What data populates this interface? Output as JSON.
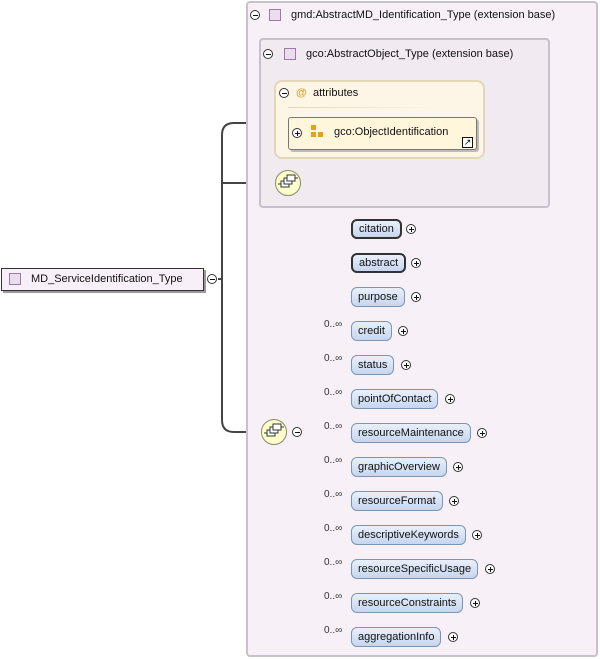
{
  "root": {
    "label": "MD_ServiceIdentification_Type"
  },
  "extension_outer": {
    "label": "gmd:AbstractMD_Identification_Type (extension base)"
  },
  "extension_inner": {
    "label": "gco:AbstractObject_Type (extension base)"
  },
  "attributes": {
    "label": "attributes",
    "symbol": "@",
    "item_label": "gco:ObjectIdentification"
  },
  "elements": [
    {
      "label": "citation",
      "cardinality": "",
      "required": true
    },
    {
      "label": "abstract",
      "cardinality": "",
      "required": true
    },
    {
      "label": "purpose",
      "cardinality": "",
      "required": false
    },
    {
      "label": "credit",
      "cardinality": "0..∞",
      "required": false
    },
    {
      "label": "status",
      "cardinality": "0..∞",
      "required": false
    },
    {
      "label": "pointOfContact",
      "cardinality": "0..∞",
      "required": false
    },
    {
      "label": "resourceMaintenance",
      "cardinality": "0..∞",
      "required": false
    },
    {
      "label": "graphicOverview",
      "cardinality": "0..∞",
      "required": false
    },
    {
      "label": "resourceFormat",
      "cardinality": "0..∞",
      "required": false
    },
    {
      "label": "descriptiveKeywords",
      "cardinality": "0..∞",
      "required": false
    },
    {
      "label": "resourceSpecificUsage",
      "cardinality": "0..∞",
      "required": false
    },
    {
      "label": "resourceConstraints",
      "cardinality": "0..∞",
      "required": false
    },
    {
      "label": "aggregationInfo",
      "cardinality": "0..∞",
      "required": false
    }
  ]
}
